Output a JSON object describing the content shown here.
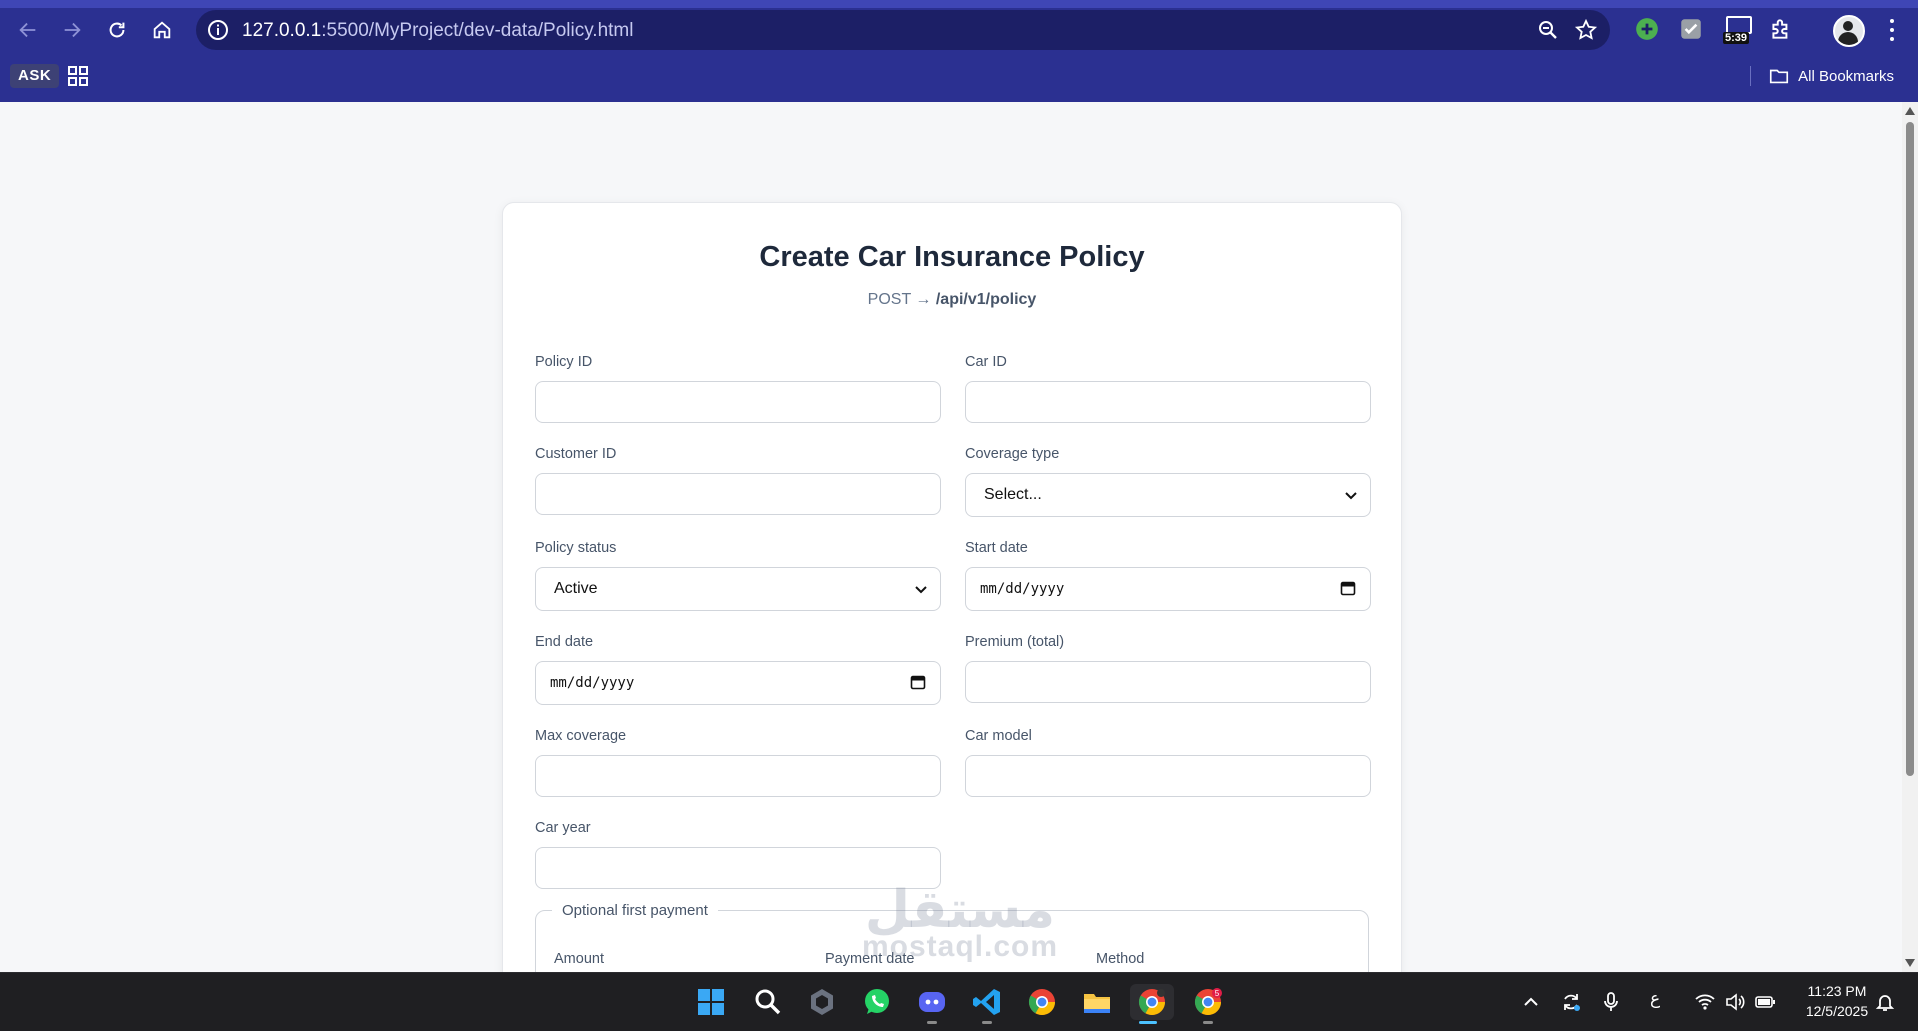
{
  "browser": {
    "url_host": "127.0.0.1",
    "url_rest": ":5500/MyProject/dev-data/Policy.html",
    "ext_badge_time": "5:39",
    "ask_chip": "ASK",
    "bookmarks_label": "All Bookmarks",
    "accent_color": "#2b3091"
  },
  "page": {
    "title": "Create Car Insurance Policy",
    "endpoint_method": "POST →",
    "endpoint_path": "/api/v1/policy",
    "fields": {
      "policy_id": {
        "label": "Policy ID",
        "value": ""
      },
      "car_id": {
        "label": "Car ID",
        "value": ""
      },
      "customer_id": {
        "label": "Customer ID",
        "value": ""
      },
      "coverage_type": {
        "label": "Coverage type",
        "value": "Select..."
      },
      "policy_status": {
        "label": "Policy status",
        "value": "Active"
      },
      "start_date": {
        "label": "Start date",
        "value": "mm/dd/yyyy"
      },
      "end_date": {
        "label": "End date",
        "value": "mm/dd/yyyy"
      },
      "premium_total": {
        "label": "Premium (total)",
        "value": ""
      },
      "max_coverage": {
        "label": "Max coverage",
        "value": ""
      },
      "car_model": {
        "label": "Car model",
        "value": ""
      },
      "car_year": {
        "label": "Car year",
        "value": ""
      }
    },
    "payment": {
      "legend": "Optional first payment",
      "amount_label": "Amount",
      "date_label": "Payment date",
      "method_label": "Method"
    },
    "watermark": {
      "arabic": "مستقل",
      "latin": "mostaql.com"
    }
  },
  "taskbar": {
    "lang": "ع",
    "time": "11:23 PM",
    "date": "12/5/2025",
    "chrome_badge": "5"
  }
}
